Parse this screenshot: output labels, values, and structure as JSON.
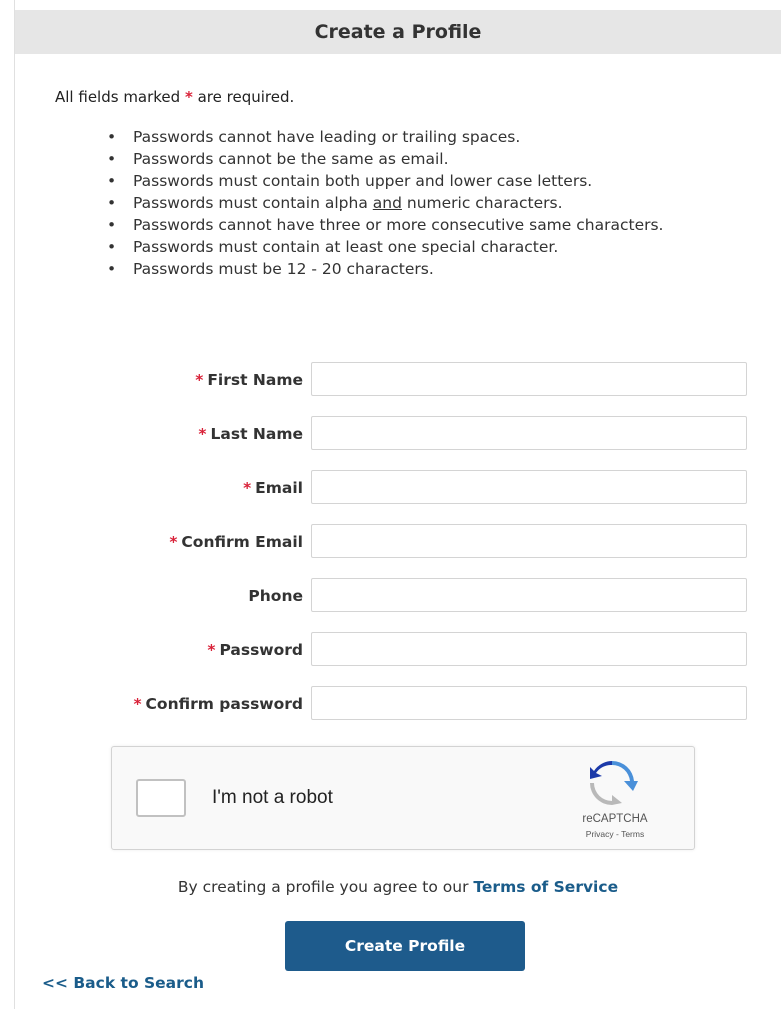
{
  "header": {
    "title": "Create a Profile"
  },
  "required_note": {
    "before": "All fields marked ",
    "star": "*",
    "after": " are required."
  },
  "password_rules": [
    "Passwords cannot have leading or trailing spaces.",
    "Passwords cannot be the same as email.",
    "Passwords must contain both upper and lower case letters.",
    {
      "before": "Passwords must contain alpha ",
      "underlined": "and",
      "after": " numeric characters."
    },
    "Passwords cannot have three or more consecutive same characters.",
    "Passwords must contain at least one special character.",
    "Passwords must be 12 - 20 characters."
  ],
  "fields": {
    "first_name": {
      "label": "First Name",
      "required": "*",
      "value": ""
    },
    "last_name": {
      "label": "Last Name",
      "required": "*",
      "value": ""
    },
    "email": {
      "label": "Email",
      "required": "*",
      "value": ""
    },
    "confirm_email": {
      "label": "Confirm Email",
      "required": "*",
      "value": ""
    },
    "phone": {
      "label": "Phone",
      "required": "",
      "value": ""
    },
    "password": {
      "label": "Password",
      "required": "*",
      "value": ""
    },
    "confirm_password": {
      "label": "Confirm password",
      "required": "*",
      "value": ""
    }
  },
  "captcha": {
    "label": "I'm not a robot",
    "brand": "reCAPTCHA",
    "privacy": "Privacy",
    "separator": " - ",
    "terms": "Terms",
    "icon": "recaptcha-logo-icon"
  },
  "agreement": {
    "text": "By creating a profile you agree to our ",
    "link": "Terms of Service"
  },
  "actions": {
    "create": "Create Profile",
    "back": "<< Back to Search"
  },
  "colors": {
    "accent": "#1e5b8c",
    "link": "#1a5c8a",
    "required_star": "#d9233a",
    "header_bg": "#e6e6e6"
  }
}
